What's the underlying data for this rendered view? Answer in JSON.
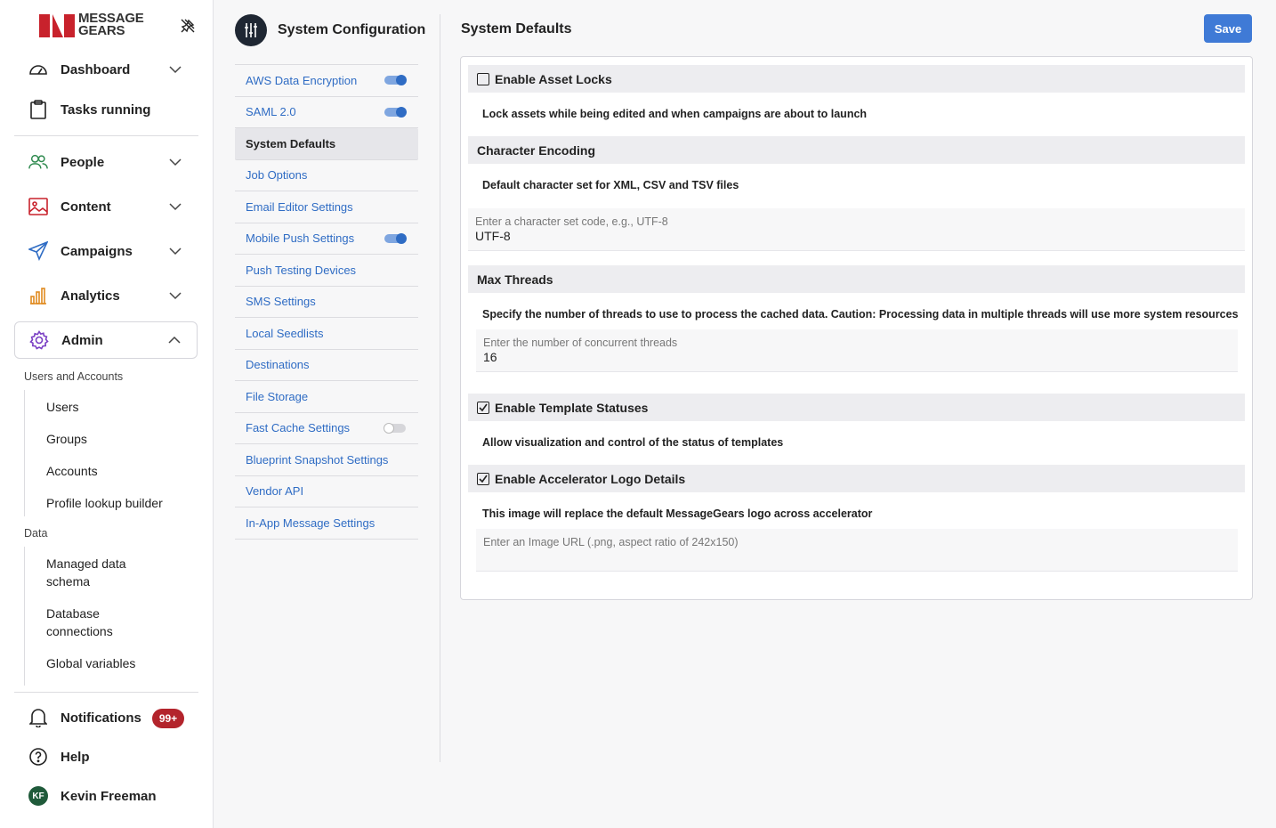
{
  "brand": {
    "line1": "MESSAGE",
    "line2": "GEARS"
  },
  "nav": {
    "dashboard": "Dashboard",
    "tasks": "Tasks running",
    "people": "People",
    "content": "Content",
    "campaigns": "Campaigns",
    "analytics": "Analytics",
    "admin": "Admin"
  },
  "admin_sections": {
    "users_accounts_label": "Users and Accounts",
    "users_accounts": [
      "Users",
      "Groups",
      "Accounts",
      "Profile lookup builder"
    ],
    "data_label": "Data",
    "data": [
      "Managed data schema",
      "Database connections",
      "Global variables"
    ]
  },
  "footer": {
    "notifications": "Notifications",
    "notifications_badge": "99+",
    "help": "Help",
    "user_name": "Kevin Freeman",
    "user_initials": "KF"
  },
  "config": {
    "title": "System Configuration",
    "items": [
      {
        "label": "AWS Data Encryption",
        "toggle": "on"
      },
      {
        "label": "SAML 2.0",
        "toggle": "on"
      },
      {
        "label": "System Defaults",
        "selected": true
      },
      {
        "label": "Job Options"
      },
      {
        "label": "Email Editor Settings"
      },
      {
        "label": "Mobile Push Settings",
        "toggle": "on"
      },
      {
        "label": "Push Testing Devices"
      },
      {
        "label": "SMS Settings"
      },
      {
        "label": "Local Seedlists"
      },
      {
        "label": "Destinations"
      },
      {
        "label": "File Storage"
      },
      {
        "label": "Fast Cache Settings",
        "toggle": "off"
      },
      {
        "label": "Blueprint Snapshot Settings"
      },
      {
        "label": "Vendor API"
      },
      {
        "label": "In-App Message Settings"
      }
    ]
  },
  "main": {
    "title": "System Defaults",
    "save_label": "Save",
    "asset_locks": {
      "label": "Enable Asset Locks",
      "checked": false,
      "desc": "Lock assets while being edited and when campaigns are about to launch"
    },
    "encoding": {
      "label": "Character Encoding",
      "desc": "Default character set for XML, CSV and TSV files",
      "placeholder": "Enter a character set code, e.g., UTF-8",
      "value": "UTF-8"
    },
    "threads": {
      "label": "Max Threads",
      "desc": "Specify the number of threads to use to process the cached data. Caution: Processing data in multiple threads will use more system resources",
      "placeholder": "Enter the number of concurrent threads",
      "value": "16"
    },
    "template_statuses": {
      "label": "Enable Template Statuses",
      "checked": true,
      "desc": "Allow visualization and control of the status of templates"
    },
    "logo_details": {
      "label": "Enable Accelerator Logo Details",
      "checked": true,
      "desc": "This image will replace the default MessageGears logo across accelerator",
      "placeholder": "Enter an Image URL (.png, aspect ratio of 242x150)",
      "value": ""
    }
  }
}
